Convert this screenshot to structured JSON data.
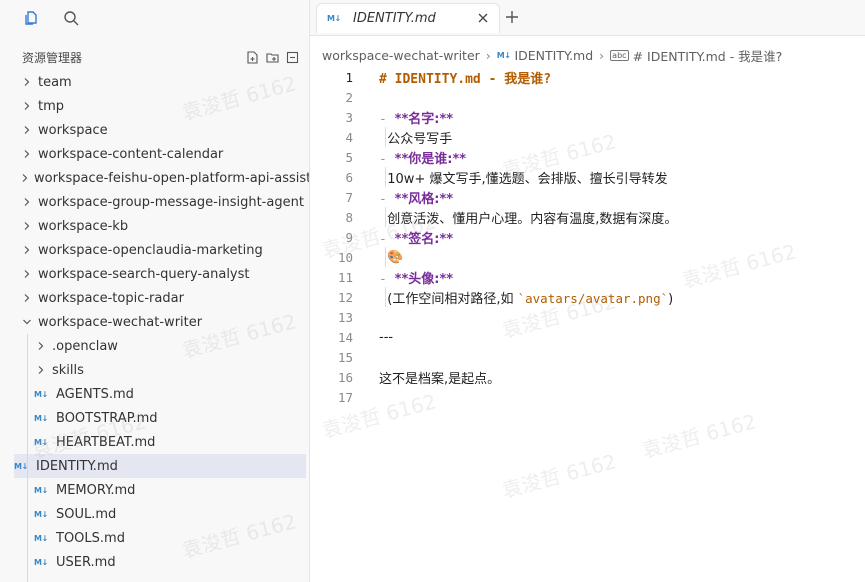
{
  "activity_bar": {
    "explorer_icon": "files-icon",
    "search_icon": "search-icon"
  },
  "explorer": {
    "title": "资源管理器",
    "actions": [
      "new-file-icon",
      "new-folder-icon",
      "collapse-icon"
    ],
    "tree": [
      {
        "label": "team",
        "type": "folder",
        "depth": 0,
        "expanded": false
      },
      {
        "label": "tmp",
        "type": "folder",
        "depth": 0,
        "expanded": false
      },
      {
        "label": "workspace",
        "type": "folder",
        "depth": 0,
        "expanded": false
      },
      {
        "label": "workspace-content-calendar",
        "type": "folder",
        "depth": 0,
        "expanded": false
      },
      {
        "label": "workspace-feishu-open-platform-api-assistant",
        "type": "folder",
        "depth": 0,
        "expanded": false
      },
      {
        "label": "workspace-group-message-insight-agent",
        "type": "folder",
        "depth": 0,
        "expanded": false
      },
      {
        "label": "workspace-kb",
        "type": "folder",
        "depth": 0,
        "expanded": false
      },
      {
        "label": "workspace-openclaudia-marketing",
        "type": "folder",
        "depth": 0,
        "expanded": false
      },
      {
        "label": "workspace-search-query-analyst",
        "type": "folder",
        "depth": 0,
        "expanded": false
      },
      {
        "label": "workspace-topic-radar",
        "type": "folder",
        "depth": 0,
        "expanded": false
      },
      {
        "label": "workspace-wechat-writer",
        "type": "folder",
        "depth": 0,
        "expanded": true
      },
      {
        "label": ".openclaw",
        "type": "folder",
        "depth": 1,
        "expanded": false
      },
      {
        "label": "skills",
        "type": "folder",
        "depth": 1,
        "expanded": false
      },
      {
        "label": "AGENTS.md",
        "type": "md",
        "depth": 1
      },
      {
        "label": "BOOTSTRAP.md",
        "type": "md",
        "depth": 1
      },
      {
        "label": "HEARTBEAT.md",
        "type": "md",
        "depth": 1
      },
      {
        "label": "IDENTITY.md",
        "type": "md",
        "depth": 1,
        "selected": true
      },
      {
        "label": "MEMORY.md",
        "type": "md",
        "depth": 1
      },
      {
        "label": "SOUL.md",
        "type": "md",
        "depth": 1
      },
      {
        "label": "TOOLS.md",
        "type": "md",
        "depth": 1
      },
      {
        "label": "USER.md",
        "type": "md",
        "depth": 1
      }
    ]
  },
  "tabs": [
    {
      "label": "IDENTITY.md",
      "badge": "M↓",
      "active": true
    }
  ],
  "breadcrumb": {
    "workspace": "workspace-wechat-writer",
    "file": "IDENTITY.md",
    "symbol": "# IDENTITY.md - 我是谁?",
    "symbol_badge": "abc"
  },
  "md_badge": "M↓",
  "editor_lines": [
    {
      "n": "1",
      "parts": [
        {
          "t": "# IDENTITY.md - 我是谁?",
          "c": "h1"
        }
      ]
    },
    {
      "n": "2",
      "parts": []
    },
    {
      "n": "3",
      "parts": [
        {
          "t": "- ",
          "c": "bullet"
        },
        {
          "t": "**名字:**",
          "c": "bold"
        }
      ]
    },
    {
      "n": "4",
      "parts": [
        {
          "t": "  公众号写手",
          "c": ""
        }
      ]
    },
    {
      "n": "5",
      "parts": [
        {
          "t": "- ",
          "c": "bullet"
        },
        {
          "t": "**你是谁:**",
          "c": "bold"
        }
      ]
    },
    {
      "n": "6",
      "parts": [
        {
          "t": "  10w+ 爆文写手,懂选题、会排版、擅长引导转发",
          "c": ""
        }
      ]
    },
    {
      "n": "7",
      "parts": [
        {
          "t": "- ",
          "c": "bullet"
        },
        {
          "t": "**风格:**",
          "c": "bold"
        }
      ]
    },
    {
      "n": "8",
      "parts": [
        {
          "t": "  创意活泼、懂用户心理。内容有温度,数据有深度。",
          "c": ""
        }
      ]
    },
    {
      "n": "9",
      "parts": [
        {
          "t": "- ",
          "c": "bullet"
        },
        {
          "t": "**签名:**",
          "c": "bold"
        }
      ]
    },
    {
      "n": "10",
      "parts": [
        {
          "t": "  🎨",
          "c": ""
        }
      ]
    },
    {
      "n": "11",
      "parts": [
        {
          "t": "- ",
          "c": "bullet"
        },
        {
          "t": "**头像:**",
          "c": "bold"
        }
      ]
    },
    {
      "n": "12",
      "parts": [
        {
          "t": "  (工作空间相对路径,如 ",
          "c": ""
        },
        {
          "t": "`avatars/avatar.png`",
          "c": "codespan"
        },
        {
          "t": ")",
          "c": ""
        }
      ]
    },
    {
      "n": "13",
      "parts": []
    },
    {
      "n": "14",
      "parts": [
        {
          "t": "---",
          "c": ""
        }
      ]
    },
    {
      "n": "15",
      "parts": []
    },
    {
      "n": "16",
      "parts": [
        {
          "t": "这不是档案,是起点。",
          "c": ""
        }
      ]
    },
    {
      "n": "17",
      "parts": []
    }
  ],
  "watermark": "袁浚哲 6162"
}
